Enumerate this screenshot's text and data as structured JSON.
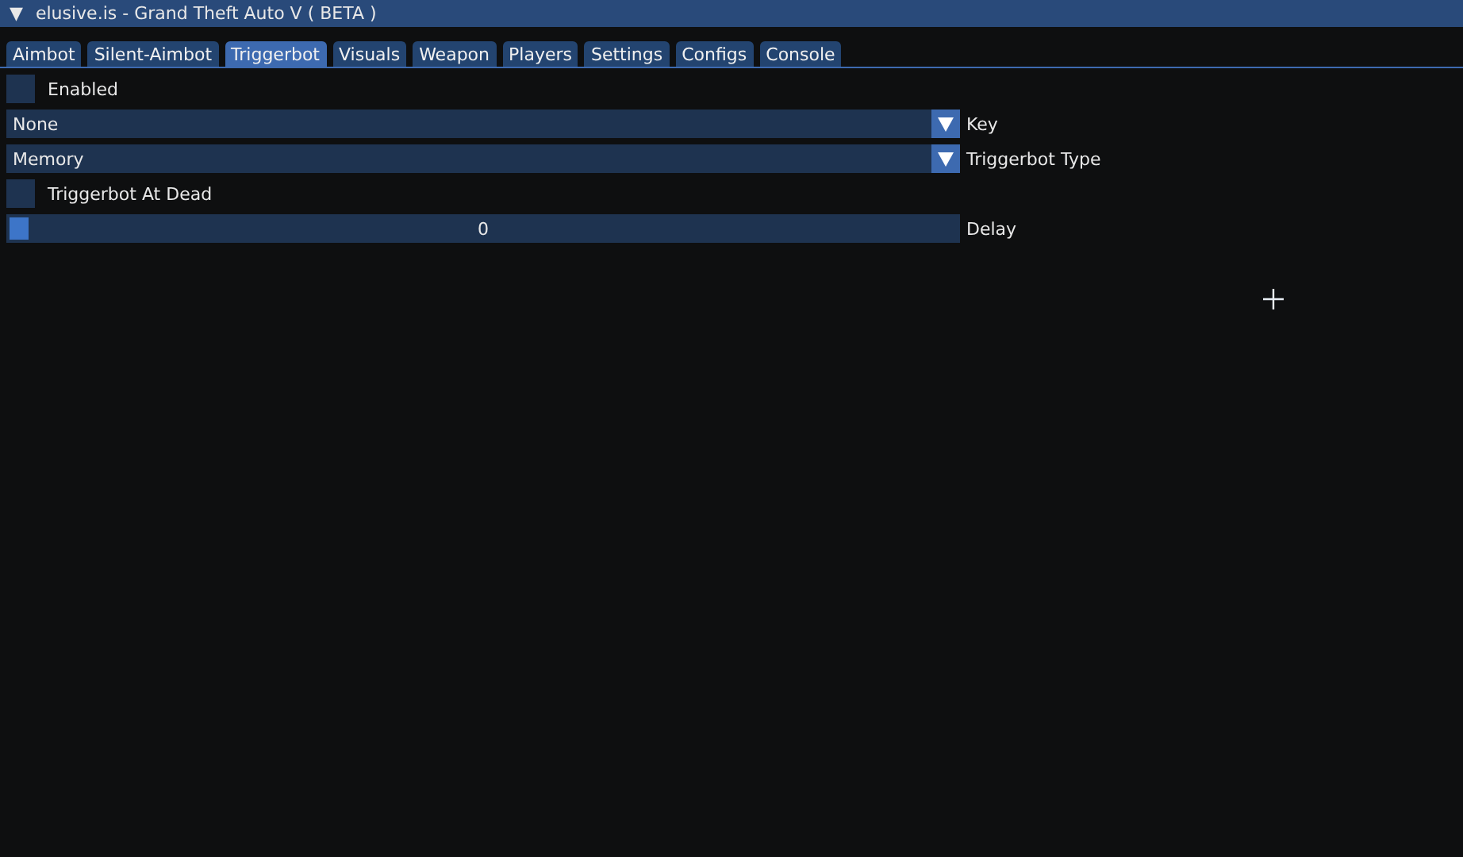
{
  "window": {
    "title": "elusive.is - Grand Theft Auto V ( BETA )",
    "collapse_glyph": "▼"
  },
  "tabs": [
    {
      "label": "Aimbot",
      "selected": false
    },
    {
      "label": "Silent-Aimbot",
      "selected": false
    },
    {
      "label": "Triggerbot",
      "selected": true
    },
    {
      "label": "Visuals",
      "selected": false
    },
    {
      "label": "Weapon",
      "selected": false
    },
    {
      "label": "Players",
      "selected": false
    },
    {
      "label": "Settings",
      "selected": false
    },
    {
      "label": "Configs",
      "selected": false
    },
    {
      "label": "Console",
      "selected": false
    }
  ],
  "controls": [
    {
      "kind": "checkbox",
      "label": "Enabled",
      "checked": false
    },
    {
      "kind": "combo",
      "label": "Key",
      "selection": "None"
    },
    {
      "kind": "combo",
      "label": "Triggerbot Type",
      "selection": "Memory"
    },
    {
      "kind": "checkbox",
      "label": "Triggerbot At Dead",
      "checked": false
    },
    {
      "kind": "slider",
      "label": "Delay",
      "value": "0",
      "level": 0
    }
  ]
}
